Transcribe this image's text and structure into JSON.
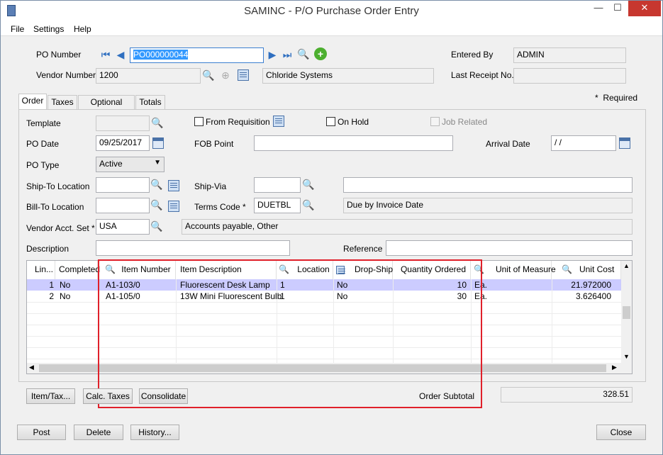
{
  "window": {
    "title": "SAMINC - P/O Purchase Order Entry",
    "minimize": "—",
    "maximize": "☐",
    "close": "✕"
  },
  "menu": {
    "file": "File",
    "settings": "Settings",
    "help": "Help"
  },
  "header": {
    "po_number_label": "PO Number",
    "po_number_value": "PO000000044",
    "vendor_number_label": "Vendor Number",
    "vendor_number_value": "1200",
    "vendor_name": "Chloride Systems",
    "entered_by_label": "Entered By",
    "entered_by_value": "ADMIN",
    "last_receipt_label": "Last Receipt No.",
    "last_receipt_value": "",
    "required_note": "Required"
  },
  "tabs": [
    "Order",
    "Taxes",
    "Optional Fields",
    "Totals"
  ],
  "order": {
    "template_label": "Template",
    "template_value": "",
    "from_requisition_label": "From Requisition",
    "on_hold_label": "On Hold",
    "job_related_label": "Job Related",
    "po_date_label": "PO Date",
    "po_date_value": "09/25/2017",
    "fob_point_label": "FOB Point",
    "fob_point_value": "",
    "arrival_date_label": "Arrival Date",
    "arrival_date_value": "/ /",
    "po_type_label": "PO Type",
    "po_type_value": "Active",
    "ship_to_label": "Ship-To Location",
    "ship_via_label": "Ship-Via",
    "bill_to_label": "Bill-To Location",
    "terms_code_label": "Terms Code *",
    "terms_code_value": "DUETBL",
    "terms_desc": "Due by Invoice Date",
    "vendor_acct_label": "Vendor Acct. Set *",
    "vendor_acct_value": "USA",
    "vendor_acct_desc": "Accounts payable, Other",
    "description_label": "Description",
    "reference_label": "Reference"
  },
  "grid": {
    "columns": [
      "Lin...",
      "Completed",
      "Item Number",
      "Item Description",
      "Location",
      "Drop-Ship",
      "Quantity Ordered",
      "Unit of Measure",
      "Unit Cost"
    ],
    "rows": [
      {
        "line": "1",
        "completed": "No",
        "item": "A1-103/0",
        "desc": "Fluorescent Desk Lamp",
        "location": "1",
        "drop": "No",
        "qty": "10",
        "uom": "Ea.",
        "cost": "21.972000"
      },
      {
        "line": "2",
        "completed": "No",
        "item": "A1-105/0",
        "desc": "13W Mini Fluorescent Bulb",
        "location": "1",
        "drop": "No",
        "qty": "30",
        "uom": "Ea.",
        "cost": "3.626400"
      }
    ]
  },
  "footer": {
    "item_tax_button": "Item/Tax...",
    "calc_taxes_button": "Calc. Taxes",
    "consolidate_button": "Consolidate",
    "order_subtotal_label": "Order Subtotal",
    "order_subtotal_value": "328.51",
    "post_button": "Post",
    "delete_button": "Delete",
    "history_button": "History...",
    "close_button": "Close"
  },
  "colors": {
    "selected_row": "#ccccff",
    "highlight_box": "#e0202a",
    "accent_blue": "#2f6fc0"
  }
}
